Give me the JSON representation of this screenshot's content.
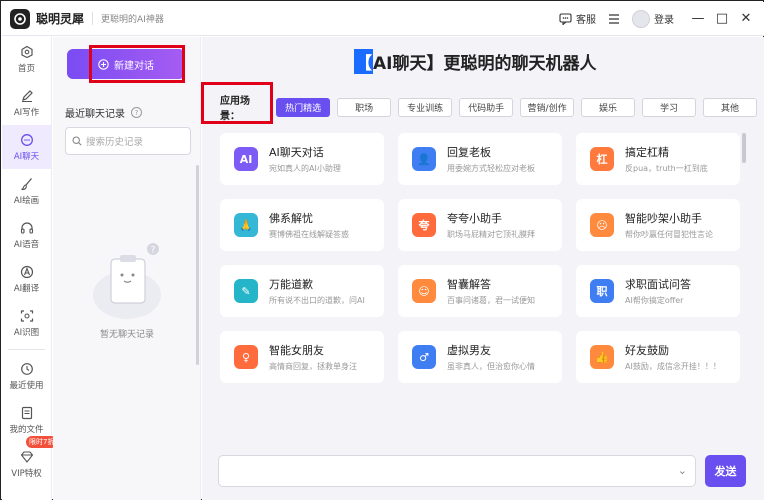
{
  "app": {
    "name": "聪明灵犀",
    "slogan": "更聪明的AI神器"
  },
  "titlebar": {
    "service": "客服",
    "login": "登录",
    "min": "—",
    "max": "□",
    "close": "✕"
  },
  "nav": {
    "items": [
      {
        "label": "首页",
        "icon": "home-icon"
      },
      {
        "label": "AI写作",
        "icon": "pen-icon"
      },
      {
        "label": "AI聊天",
        "icon": "chat-icon"
      },
      {
        "label": "AI绘画",
        "icon": "brush-icon"
      },
      {
        "label": "AI语音",
        "icon": "headset-icon"
      },
      {
        "label": "AI翻译",
        "icon": "translate-icon"
      },
      {
        "label": "AI识图",
        "icon": "scan-icon"
      }
    ],
    "recent": "最近使用",
    "files": "我的文件",
    "vip": "VIP特权",
    "vip_badge": "限时7折"
  },
  "history": {
    "new_chat": "新建对话",
    "title": "最近聊天记录",
    "search_placeholder": "搜索历史记录",
    "empty": "暂无聊天记录"
  },
  "main": {
    "headline_bracket": "【",
    "headline_tag": "AI聊天】",
    "headline_rest": " 更聪明的聊天机器人",
    "scene_label": "应用场景：",
    "scenes": [
      "热门精选",
      "职场",
      "专业训练",
      "代码助手",
      "营销/创作",
      "娱乐",
      "学习",
      "其他"
    ],
    "cards": [
      {
        "title": "AI聊天对话",
        "desc": "宛如真人的AI小助理",
        "color": "#7d5cf5",
        "glyph": "AI"
      },
      {
        "title": "回复老板",
        "desc": "用委婉方式轻松应对老板",
        "color": "#3f7df2",
        "glyph": "👤"
      },
      {
        "title": "搞定杠精",
        "desc": "反pua，truth一杠到底",
        "color": "#ff7a3c",
        "glyph": "杠"
      },
      {
        "title": "佛系解忧",
        "desc": "赛博佛祖在线解疑答惑",
        "color": "#35b8d6",
        "glyph": "🙏"
      },
      {
        "title": "夸夸小助手",
        "desc": "职场马屁精对它顶礼膜拜",
        "color": "#ff6b3d",
        "glyph": "夸"
      },
      {
        "title": "智能吵架小助手",
        "desc": "帮你吵赢任何冒犯性言论",
        "color": "#ff8a3d",
        "glyph": "☹"
      },
      {
        "title": "万能道歉",
        "desc": "所有说不出口的道歉，问AI",
        "color": "#25b5c8",
        "glyph": "✎"
      },
      {
        "title": "智囊解答",
        "desc": "百事问诸葛，君一试便知",
        "color": "#ff8a3d",
        "glyph": "☺"
      },
      {
        "title": "求职面试问答",
        "desc": "AI帮你搞定offer",
        "color": "#3f7df2",
        "glyph": "职"
      },
      {
        "title": "智能女朋友",
        "desc": "高情商回复，拯救单身汪",
        "color": "#ff6b3d",
        "glyph": "♀"
      },
      {
        "title": "虚拟男友",
        "desc": "虽非真人，但治愈你心情",
        "color": "#3f7df2",
        "glyph": "♂"
      },
      {
        "title": "好友鼓励",
        "desc": "AI鼓励，成信念开挂！！！",
        "color": "#ff8a3d",
        "glyph": "👍"
      }
    ],
    "send": "发送"
  },
  "colors": {
    "accent": "#6a4ff0",
    "highlight": "#e0001a"
  }
}
